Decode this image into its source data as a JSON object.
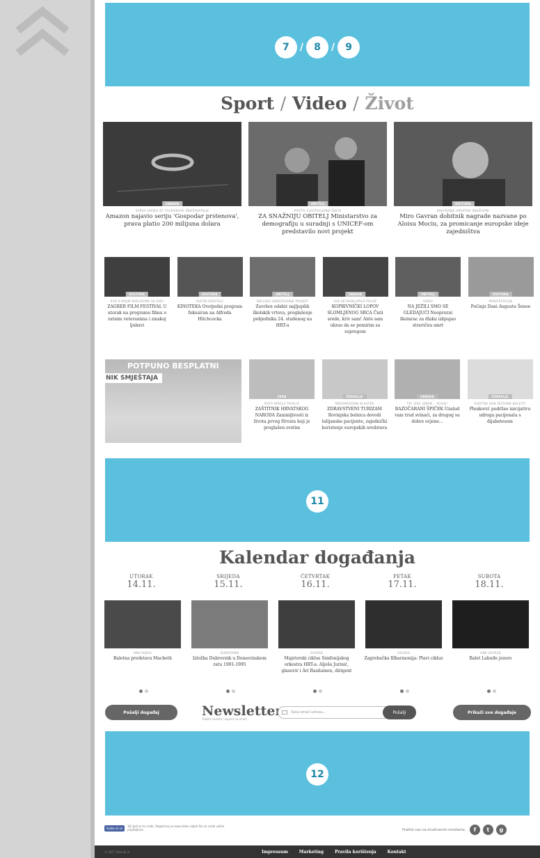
{
  "ads": {
    "top": {
      "nums": [
        "7",
        "8",
        "9"
      ],
      "sep": "/"
    },
    "middle": {
      "num": "11"
    },
    "bottom": {
      "num": "12"
    }
  },
  "section": {
    "title_part1": "Sport",
    "sep1": "/",
    "title_part2": "Video",
    "sep2": "/",
    "title_part3": "Život"
  },
  "big_articles": [
    {
      "tag": "ZABAVA",
      "kicker": "SUPER USPJEH ZA TOLKIENOVE OBOŽAVATELJE",
      "headline": "Amazon najavio seriju 'Gospodar prstenova', prava platio 200 milijuna dolara",
      "color": "#3b3b3b"
    },
    {
      "tag": "OBITELJ",
      "kicker": "PROTIV ZLOSTAVLJANJA DJECE",
      "headline": "ZA SNAŽNIJU OBITELJ Ministarstvo za demografiju u suradnji s UNICEF-om predstavilo novi projekt",
      "color": "#6b6b6b"
    },
    {
      "tag": "KULTURA",
      "kicker": "NAJVIŠANJE HRVATSKI OKOŽIVANI",
      "headline": "Miro Gavran dobitnik nagrade nazvane po Aloisu Mociu, za promicanje europske ideje zajedništva",
      "color": "#5a5a5a"
    }
  ],
  "small_row1": [
    {
      "tag": "KULTURA",
      "kicker": "EVO O KOJIM NASLOVIMA SE RADI",
      "headline": "ZAGREB FILM FESTIVAL U utorak na programu filmu o ratnim veteranima i zmskoj ljubavi",
      "color": "#3f3f3f"
    },
    {
      "tag": "KULTURA",
      "kicker": "KULTNI REDATELJ",
      "headline": "KINOTEKA Ovotjedni program fokusiran na Alfreda Hitchcocka",
      "color": "#555555"
    },
    {
      "tag": "OBITELJ",
      "kicker": "ŠKOLSKO OBREZOVANJE PROJEKT",
      "headline": "Završen odabir najljepših školskih vrtova, proglašenje pobjednika 24. studenog na HRT-u",
      "color": "#6e6e6e"
    },
    {
      "tag": "ZABAVA",
      "kicker": "SVE SE RASKLAPILO POLOŽ",
      "headline": "KOPRIVNIČKI LOPOV SLOMLJENOG SRCA Čisti srede, kriv sam! Ante sam ukrao da se pomirim sa suprugom",
      "color": "#444444"
    },
    {
      "tag": "OBITELJ",
      "kicker": "VIDEO",
      "headline": "NA JEŽILI SMO SE GLEDAJUĆI Neopreznі školarac za dlaku izbjegao stravičnu smrt",
      "color": "#5f5f5f"
    },
    {
      "tag": "KULTURA",
      "kicker": "MANIFESTACIJE",
      "headline": "Počinju Dani Augusta Šenoe",
      "color": "#9a9a9a"
    }
  ],
  "promo": {
    "line1": "POTPUNO BESPLATNI",
    "line2": "NIK SMJEŠTAJA"
  },
  "small_row2": [
    {
      "tag": "VERA",
      "kicker": "SVETI NIKOLA TAVELIĆ",
      "headline": "ZAŠTITNIK HRVATSKOG NARODA Zanimljivosti iz života prvog Hrvata koji je proglašen svetim",
      "color": "#bdbdbd"
    },
    {
      "tag": "ZDRAVLJE",
      "kicker": "MEDUNARODNI KLASTER",
      "headline": "ZDRAVSTVENI TURIZAM Rovinjska bolnica dovodi talijanske pacijente, zajednički koristenje europskih sredstava",
      "color": "#c8c8c8"
    },
    {
      "tag": "ZABAVA",
      "kicker": "TRI, DVA, JEDAN... KUHAJ!",
      "headline": "RAZOČARANI ŠPIČEK Uzalud vam trud svinaći, za drugog su dobre ocjene...",
      "color": "#b0b0b0"
    },
    {
      "tag": "ZDRAVLJE",
      "kicker": "SVJETSKI DAN ŠEĆERNE BOLESTI",
      "headline": "Plenković podržao inicijativu udruga pacijenata s dijabetesom",
      "color": "#dcdcdc"
    }
  ],
  "calendar": {
    "title": "Kalendar događanja",
    "days": [
      {
        "name": "UTORAK",
        "date": "14.11.",
        "kicker": "HNK RIJEKA",
        "headline": "Baletna predstava Macbeth",
        "color": "#4a4a4a"
      },
      {
        "name": "SRIJEDA",
        "date": "15.11.",
        "kicker": "DUBROVNIK",
        "headline": "Izložba Dubrovnik u Domovinskom ratu 1991-1995",
        "color": "#7b7b7b"
      },
      {
        "name": "ČETVRTAK",
        "date": "16.11.",
        "kicker": "ZAGREB",
        "headline": "Majstorski ciklus Simfonijskog orkestra HRT-a: Aljoša Jurinić, glasovir i Ari Rasilainen, dirigent",
        "color": "#3e3e3e"
      },
      {
        "name": "PETAK",
        "date": "17.11.",
        "kicker": "ZAGREB",
        "headline": "Zagrebačka filharmonija: Plavi ciklus",
        "color": "#2e2e2e"
      },
      {
        "name": "SUBOTA",
        "date": "18.11.",
        "kicker": "HNK ZAGREB",
        "headline": "Balet Labuđe jezero",
        "color": "#1e1e1e"
      }
    ]
  },
  "newsletter": {
    "send_event": "Pošalji događaj",
    "title": "Newsletter",
    "subtitle": "Tražite novosti i kuponi na email",
    "placeholder": "Vaša email adresa...",
    "submit": "Pošalji",
    "show_all": "Prikaži sve događaje"
  },
  "footer": {
    "like_label": "Sviđa mi se",
    "like_text": "18 ljudi se to sviđa. Registriraj se kako biste vidjeli što se sviđa vašim prijateljima.",
    "follow_text": "Pratite nas na društvenim mrežama",
    "icons": [
      "f",
      "t",
      "g"
    ],
    "copyright": "© 2017 Sibenik.in",
    "links": [
      "Impressum",
      "Marketing",
      "Pravila korištenja",
      "Kontakt"
    ]
  }
}
